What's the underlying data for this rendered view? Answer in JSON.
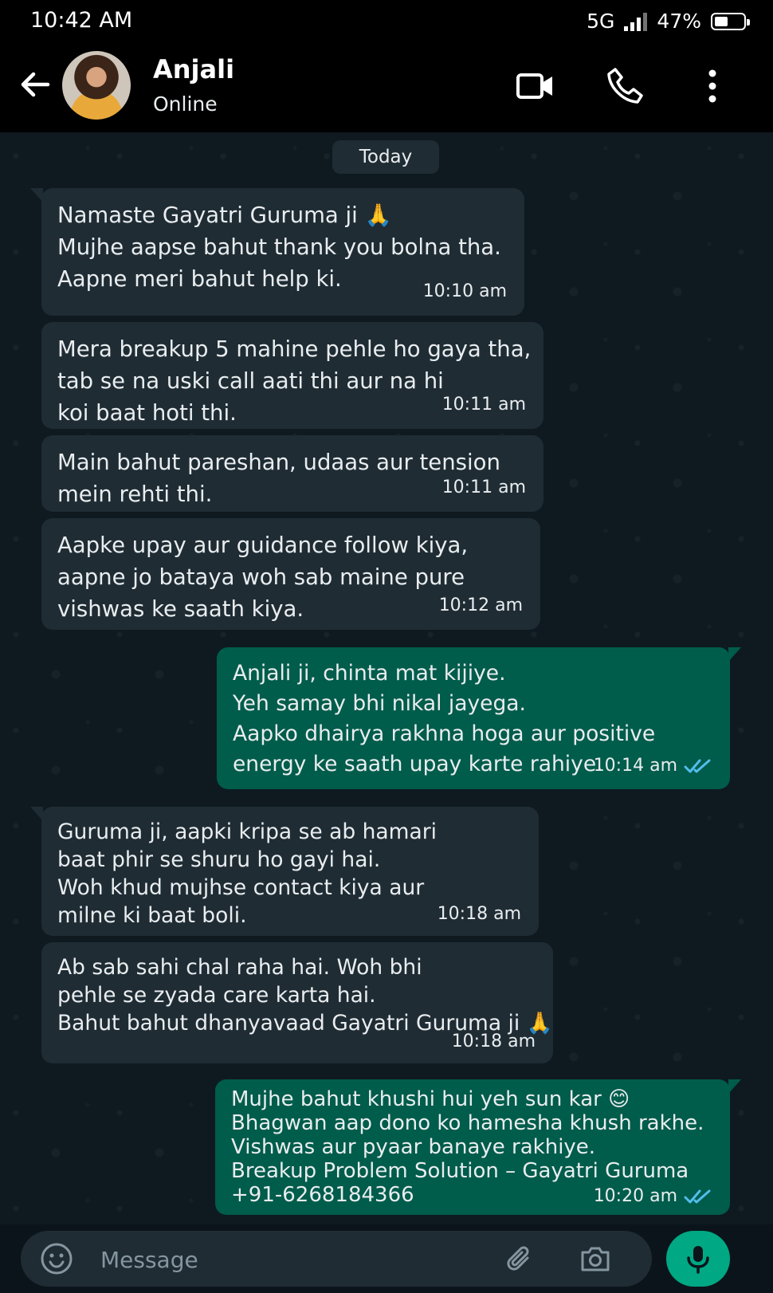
{
  "status_bar": {
    "time": "10:42 AM",
    "network": "5G",
    "battery": "47%"
  },
  "header": {
    "name": "Anjali",
    "status": "Online"
  },
  "date_chip": "Today",
  "messages": [
    {
      "dir": "in",
      "lines": [
        "Namaste Gayatri Guruma ji 🙏",
        "Mujhe aapse bahut thank you bolna tha.",
        "Aapne meri bahut help ki."
      ],
      "time": "10:10 am"
    },
    {
      "dir": "in",
      "lines": [
        "Mera breakup 5 mahine pehle ho gaya tha,",
        "tab se na uski call aati thi aur na hi",
        "koi baat hoti thi."
      ],
      "time": "10:11 am"
    },
    {
      "dir": "in",
      "lines": [
        "Main bahut pareshan, udaas aur tension",
        "mein rehti thi."
      ],
      "time": "10:11 am"
    },
    {
      "dir": "in",
      "lines": [
        "Aapke upay aur guidance follow kiya,",
        "aapne jo bataya woh sab maine pure",
        "vishwas ke saath kiya."
      ],
      "time": "10:12 am"
    },
    {
      "dir": "out",
      "lines": [
        "Anjali ji, chinta mat kijiye.",
        "Yeh samay bhi nikal jayega.",
        "Aapko dhairya rakhna hoga aur positive",
        "energy ke saath upay karte rahiye."
      ],
      "time": "10:14 am"
    },
    {
      "dir": "in",
      "lines": [
        "Guruma ji, aapki kripa se ab hamari",
        "baat phir se shuru ho gayi hai.",
        "Woh khud mujhse contact kiya aur",
        "milne ki baat boli."
      ],
      "time": "10:18 am"
    },
    {
      "dir": "in",
      "lines": [
        "Ab sab sahi chal raha hai. Woh bhi",
        "pehle se zyada care karta hai.",
        "Bahut bahut dhanyavaad Gayatri Guruma ji 🙏"
      ],
      "time": "10:18 am"
    },
    {
      "dir": "out",
      "lines": [
        "Mujhe bahut khushi hui yeh sun kar 😊",
        "Bhagwan aap dono ko hamesha khush rakhe.",
        "Vishwas aur pyaar banaye rakhiye.",
        "Breakup Problem Solution – Gayatri Guruma",
        "+91-6268184366"
      ],
      "time": "10:20 am"
    }
  ],
  "composer": {
    "placeholder": "Message"
  },
  "icons": {
    "back": "back-arrow-icon",
    "video": "video-call-icon",
    "call": "phone-call-icon",
    "menu": "more-vertical-icon",
    "emoji": "emoji-icon",
    "attach": "paperclip-icon",
    "camera": "camera-icon",
    "mic": "microphone-icon",
    "read": "double-check-icon"
  },
  "colors": {
    "incoming": "#1f2c34",
    "outgoing": "#005c4b",
    "accent": "#00a884",
    "read_ticks": "#53bdeb"
  }
}
